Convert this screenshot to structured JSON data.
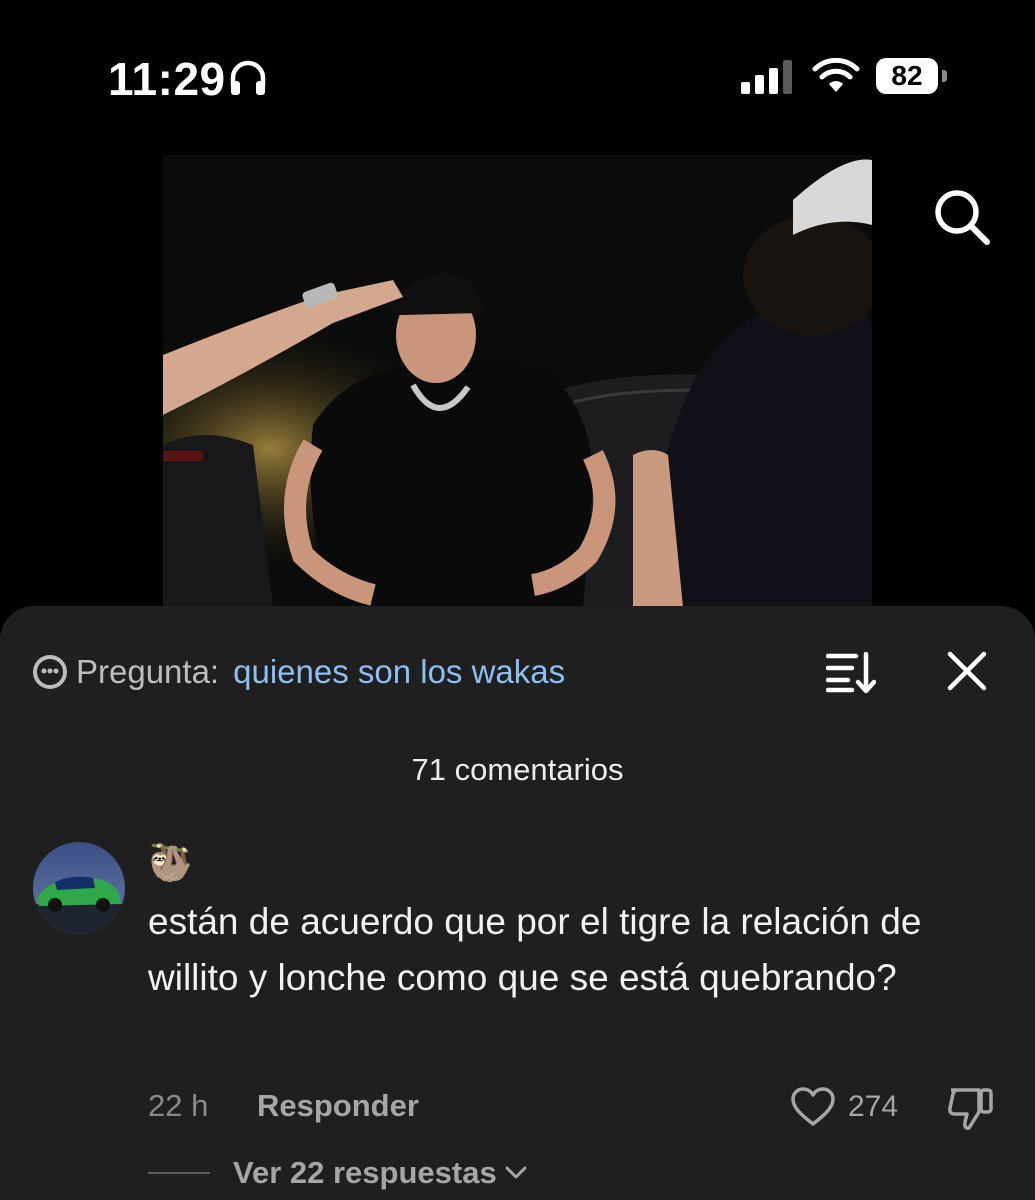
{
  "status_bar": {
    "time": "11:29",
    "battery_level": "82",
    "icons": [
      "headphones-icon",
      "signal-icon",
      "wifi-icon",
      "battery-icon"
    ]
  },
  "video": {
    "icons": [
      "search-icon"
    ]
  },
  "comments_sheet": {
    "question_prefix": "Pregunta:",
    "question_text": "quienes son los wakas",
    "icons": [
      "question-icon",
      "sort-icon",
      "close-icon"
    ],
    "comments_count": "71 comentarios",
    "comment": {
      "username": "🦥",
      "text": "están de acuerdo que por el tigre la relación de willito y lonche como que se está quebrando?",
      "time": "22 h",
      "reply_label": "Responder",
      "like_count": "274",
      "view_replies_label": "Ver 22 respuestas",
      "icons": [
        "avatar",
        "like-icon",
        "dislike-icon",
        "chevron-down-icon"
      ]
    }
  },
  "colors": {
    "background": "#000000",
    "sheet": "#1f1f1f",
    "link": "#8fbef3",
    "muted": "#a6a6a6"
  }
}
